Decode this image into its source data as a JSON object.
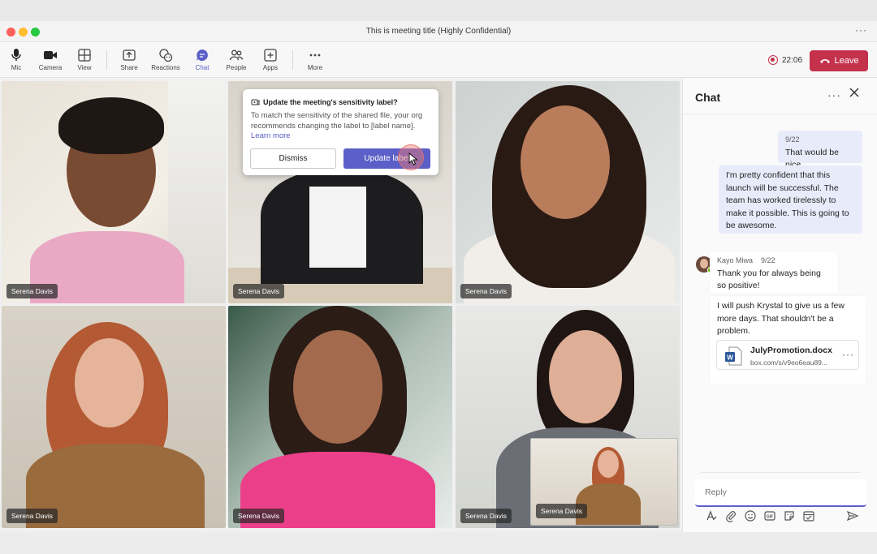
{
  "window": {
    "title": "This is meeting title (Highly Confidential)"
  },
  "toolbar": {
    "items": [
      {
        "label": "Mic",
        "icon": "mic-icon"
      },
      {
        "label": "Camera",
        "icon": "camera-icon"
      },
      {
        "label": "View",
        "icon": "grid-icon"
      },
      {
        "label": "Share",
        "icon": "share-icon"
      },
      {
        "label": "Reactions",
        "icon": "reactions-icon"
      },
      {
        "label": "Chat",
        "icon": "chat-icon"
      },
      {
        "label": "People",
        "icon": "people-icon"
      },
      {
        "label": "Apps",
        "icon": "apps-icon"
      },
      {
        "label": "More",
        "icon": "more-icon"
      }
    ],
    "timer": "22:06",
    "leave_label": "Leave",
    "leave_color": "#c4314b",
    "accent": "#5b5fc7"
  },
  "participants": [
    {
      "name": "Serena Davis"
    },
    {
      "name": "Serena Davis"
    },
    {
      "name": "Serena Davis"
    },
    {
      "name": "Serena Davis"
    },
    {
      "name": "Serena Davis"
    },
    {
      "name": "Serena Davis"
    },
    {
      "name": "Serena Davis"
    }
  ],
  "sensitivity_popup": {
    "title": "Update the meeting's sensitivity label?",
    "body": "To match the sensitivity of the shared file, your org recommends changing the label to [label name].",
    "link": "Learn more",
    "dismiss_label": "Dismiss",
    "update_label": "Update label"
  },
  "chat": {
    "title": "Chat",
    "messages": [
      {
        "meta": "9/22",
        "text": "That would be nice"
      },
      {
        "text": "I'm pretty confident that this launch will be successful. The team has worked tirelessly to make it possible. This is going to be awesome."
      },
      {
        "author": "Kayo Miwa",
        "meta": "9/22",
        "text": "Thank you for always being so positive!"
      },
      {
        "text": "I will push Krystal to give us a few more days. That shouldn't be a problem."
      }
    ],
    "file": {
      "name": "JulyPromotion.docx",
      "url": "box.com/s/v9eo6eau89..."
    },
    "reply_placeholder": "Reply"
  }
}
